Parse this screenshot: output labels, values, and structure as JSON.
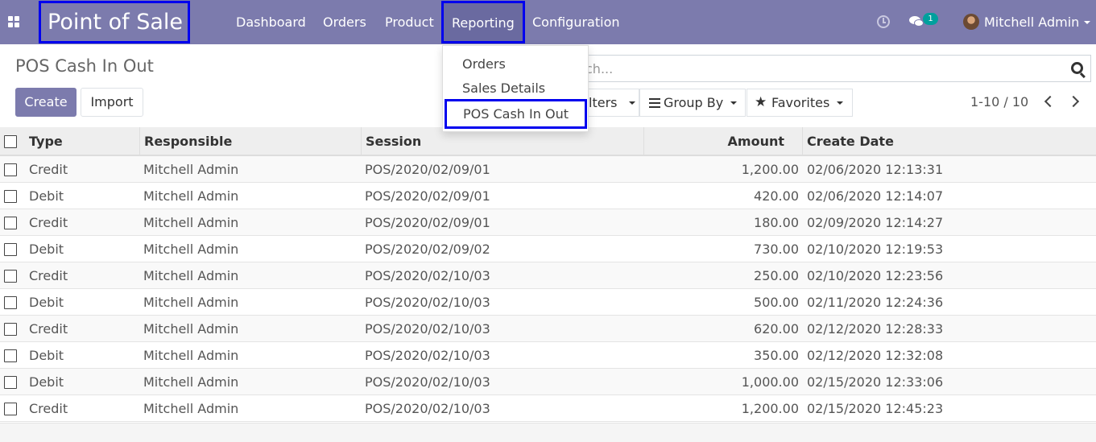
{
  "navbar": {
    "app_title": "Point of Sale",
    "menu": [
      "Dashboard",
      "Orders",
      "Product",
      "Reporting",
      "Configuration"
    ],
    "active_menu": "Reporting",
    "chat_count": "1",
    "user_name": "Mitchell Admin",
    "color": "#7c7bad"
  },
  "reporting_dropdown": {
    "items": [
      "Orders",
      "Sales Details",
      "POS Cash In Out"
    ],
    "highlighted": "POS Cash In Out"
  },
  "control_panel": {
    "title": "POS Cash In Out",
    "create_label": "Create",
    "import_label": "Import",
    "search_placeholder_visible": "ch...",
    "filters_label_visible": "lters",
    "group_by_label": "Group By",
    "favorites_label": "Favorites",
    "pager": "1-10 / 10"
  },
  "table": {
    "columns": [
      "Type",
      "Responsible",
      "Session",
      "Amount",
      "Create Date"
    ],
    "rows": [
      {
        "type": "Credit",
        "responsible": "Mitchell Admin",
        "session": "POS/2020/02/09/01",
        "amount": "1,200.00",
        "date": "02/06/2020 12:13:31"
      },
      {
        "type": "Debit",
        "responsible": "Mitchell Admin",
        "session": "POS/2020/02/09/01",
        "amount": "420.00",
        "date": "02/06/2020 12:14:07"
      },
      {
        "type": "Credit",
        "responsible": "Mitchell Admin",
        "session": "POS/2020/02/09/01",
        "amount": "180.00",
        "date": "02/09/2020 12:14:27"
      },
      {
        "type": "Debit",
        "responsible": "Mitchell Admin",
        "session": "POS/2020/02/09/02",
        "amount": "730.00",
        "date": "02/10/2020 12:19:53"
      },
      {
        "type": "Credit",
        "responsible": "Mitchell Admin",
        "session": "POS/2020/02/10/03",
        "amount": "250.00",
        "date": "02/10/2020 12:23:56"
      },
      {
        "type": "Debit",
        "responsible": "Mitchell Admin",
        "session": "POS/2020/02/10/03",
        "amount": "500.00",
        "date": "02/11/2020 12:24:36"
      },
      {
        "type": "Credit",
        "responsible": "Mitchell Admin",
        "session": "POS/2020/02/10/03",
        "amount": "620.00",
        "date": "02/12/2020 12:28:33"
      },
      {
        "type": "Debit",
        "responsible": "Mitchell Admin",
        "session": "POS/2020/02/10/03",
        "amount": "350.00",
        "date": "02/12/2020 12:32:08"
      },
      {
        "type": "Debit",
        "responsible": "Mitchell Admin",
        "session": "POS/2020/02/10/03",
        "amount": "1,000.00",
        "date": "02/15/2020 12:33:06"
      },
      {
        "type": "Credit",
        "responsible": "Mitchell Admin",
        "session": "POS/2020/02/10/03",
        "amount": "1,200.00",
        "date": "02/15/2020 12:45:23"
      }
    ]
  }
}
